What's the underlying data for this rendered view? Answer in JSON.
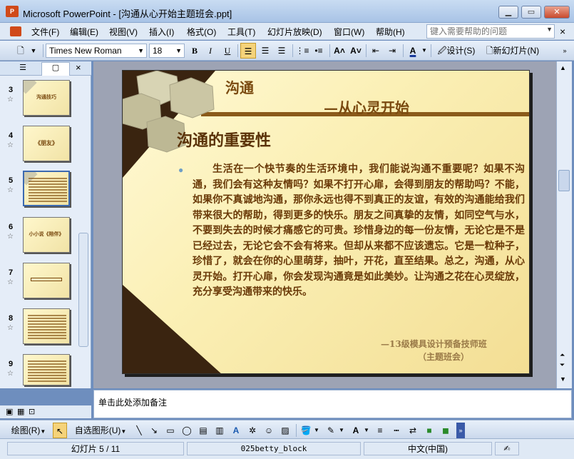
{
  "window": {
    "title": "Microsoft PowerPoint - [沟通从心开始主题班会.ppt]",
    "app_icon": "P"
  },
  "menu": [
    "文件(F)",
    "编辑(E)",
    "视图(V)",
    "插入(I)",
    "格式(O)",
    "工具(T)",
    "幻灯片放映(D)",
    "窗口(W)",
    "帮助(H)"
  ],
  "help_search": {
    "placeholder": "键入需要帮助的问题"
  },
  "toolbar": {
    "font": "Times New Roman",
    "size": "18",
    "bold": "B",
    "italic": "I",
    "underline": "U",
    "design_label": "设计(S)",
    "new_slide_label": "新幻灯片(N)"
  },
  "slides": [
    {
      "num": "3",
      "text": "沟通技巧"
    },
    {
      "num": "4",
      "text": "《朋友》"
    },
    {
      "num": "5",
      "text": ""
    },
    {
      "num": "6",
      "text": "小小说《陪伴》"
    },
    {
      "num": "7",
      "text": ""
    },
    {
      "num": "8",
      "text": ""
    },
    {
      "num": "9",
      "text": ""
    }
  ],
  "slide": {
    "title_line1": "沟通",
    "title_line2": "—从心灵开始",
    "heading": "沟通的重要性",
    "body": "生活在一个快节奏的生活环境中，我们能说沟通不重要呢？如果不沟通，我们会有这种友情吗？如果不打开心扉，会得到朋友的帮助吗？不能，如果你不真诚地沟通，那你永远也得不到真正的友谊，有效的沟通能给我们带来很大的帮助，得到更多的快乐。朋友之间真挚的友情，如同空气与水，不要到失去的时候才痛感它的可贵。珍惜身边的每一份友情，无论它是不是已经过去，无论它会不会有将来。但却从来都不应该遗忘。它是一粒种子，珍惜了，就会在你的心里萌芽，抽叶，开花，直至结果。总之，沟通，从心灵开始。打开心扉，你会发现沟通竟是如此美妙。让沟通之花在心灵绽放，充分享受沟通带来的快乐。",
    "footer1": "—13级模具设计预备技师班",
    "footer2": "（主题班会）"
  },
  "notes_placeholder": "单击此处添加备注",
  "drawbar": {
    "draw_label": "绘图(R)",
    "autoshape_label": "自选图形(U)"
  },
  "status": {
    "slide": "幻灯片 5 / 11",
    "template": "025betty_block",
    "language": "中文(中国)"
  }
}
